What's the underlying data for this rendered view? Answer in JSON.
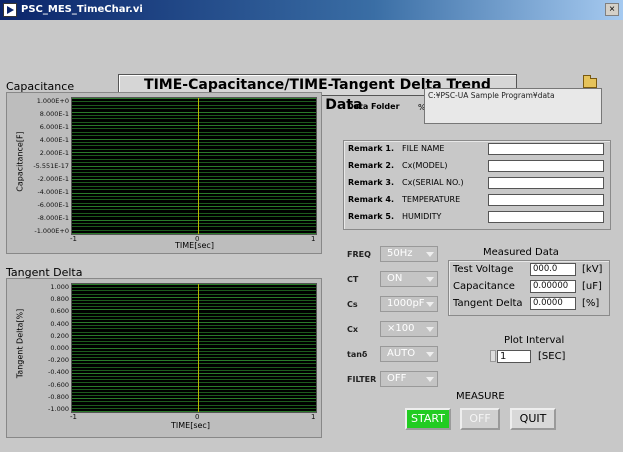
{
  "window": {
    "title": "PSC_MES_TimeChar.vi",
    "close_glyph": "×"
  },
  "main_title": "TIME-Capacitance/TIME-Tangent Delta Trend Graph Data",
  "capacitance_plot": {
    "label": "Capacitance",
    "ylabel": "Capacitance[F]",
    "xlabel": "TIME[sec]",
    "yticks": [
      "1.000E+0",
      "8.000E-1",
      "6.000E-1",
      "4.000E-1",
      "2.000E-1",
      "-5.551E-17",
      "-2.000E-1",
      "-4.000E-1",
      "-6.000E-1",
      "-8.000E-1",
      "-1.000E+0"
    ],
    "xticks": [
      "-1",
      "0",
      "1"
    ]
  },
  "tangent_plot": {
    "label": "Tangent Delta",
    "ylabel": "Tangent Delta[%]",
    "xlabel": "TIME[sec]",
    "yticks": [
      "1.000",
      "0.800",
      "0.600",
      "0.400",
      "0.200",
      "0.000",
      "-0.200",
      "-0.400",
      "-0.600",
      "-0.800",
      "-1.000"
    ],
    "xticks": [
      "-1",
      "0",
      "1"
    ]
  },
  "data_folder": {
    "label": "Data Folder",
    "prefix": "%",
    "path": "C:¥PSC-UA Sample Program¥data"
  },
  "remarks": [
    {
      "label": "Remark 1.",
      "name": "FILE NAME",
      "value": ""
    },
    {
      "label": "Remark 2.",
      "name": "Cx(MODEL)",
      "value": ""
    },
    {
      "label": "Remark 3.",
      "name": "Cx(SERIAL NO.)",
      "value": ""
    },
    {
      "label": "Remark 4.",
      "name": "TEMPERATURE",
      "value": ""
    },
    {
      "label": "Remark 5.",
      "name": "HUMIDITY",
      "value": ""
    }
  ],
  "controls": [
    {
      "label": "FREQ",
      "value": "50Hz"
    },
    {
      "label": "CT",
      "value": "ON"
    },
    {
      "label": "Cs",
      "value": "1000pF"
    },
    {
      "label": "Cx",
      "value": "×100"
    },
    {
      "label": "tanδ",
      "value": "AUTO"
    },
    {
      "label": "FILTER",
      "value": "OFF"
    }
  ],
  "measured": {
    "title": "Measured Data",
    "rows": [
      {
        "label": "Test Voltage",
        "value": "000.0",
        "unit": "[kV]"
      },
      {
        "label": "Capacitance",
        "value": "0.00000",
        "unit": "[uF]"
      },
      {
        "label": "Tangent Delta",
        "value": "0.0000",
        "unit": "[%]"
      }
    ]
  },
  "plot_interval": {
    "title": "Plot Interval",
    "value": "1",
    "unit": "[SEC]"
  },
  "measure": {
    "label": "MEASURE",
    "start": "START",
    "off": "OFF",
    "quit": "QUIT"
  },
  "colors": {
    "plot_bg": "#000000",
    "grid": "#2a7a2a",
    "cursor": "#b8b800",
    "start_button": "#22cc22"
  }
}
